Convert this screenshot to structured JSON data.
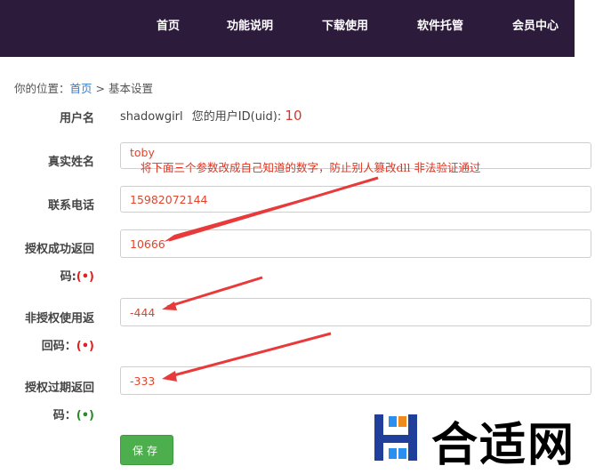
{
  "nav": {
    "items": [
      "首页",
      "功能说明",
      "下载使用",
      "软件托管",
      "会员中心"
    ]
  },
  "breadcrumb": {
    "prefix": "你的位置：",
    "home": "首页",
    "separator": " > ",
    "current": "基本设置"
  },
  "form": {
    "username": {
      "label": "用户名",
      "value": "shadowgirl",
      "uid_text": "您的用户ID(uid):",
      "uid": "10"
    },
    "realname": {
      "label": "真实姓名",
      "value": "toby"
    },
    "phone": {
      "label": "联系电话",
      "value": "15982072144"
    },
    "success_code": {
      "label_line1": "授权成功返回",
      "label_line2": "码:",
      "required": "(•)",
      "value": "10666"
    },
    "unauth_code": {
      "label_line1": "非授权使用返",
      "label_line2": "回码：",
      "required": "(•)",
      "value": "-444"
    },
    "expired_code": {
      "label_line1": "授权过期返回",
      "label_line2": "码：",
      "required": "(•)",
      "value": "-333"
    },
    "save_label": "保存"
  },
  "annotation": {
    "text": "将下面三个参数改成自己知道的数字，防止别人篡改dll 非法验证通过",
    "color": "#e0341f"
  },
  "watermark": {
    "text": "合适网"
  },
  "colors": {
    "nav_bg": "#2c1b3b",
    "accent_link": "#3a7cc4",
    "value_red": "#e2442b",
    "save_green": "#4cae4c"
  }
}
